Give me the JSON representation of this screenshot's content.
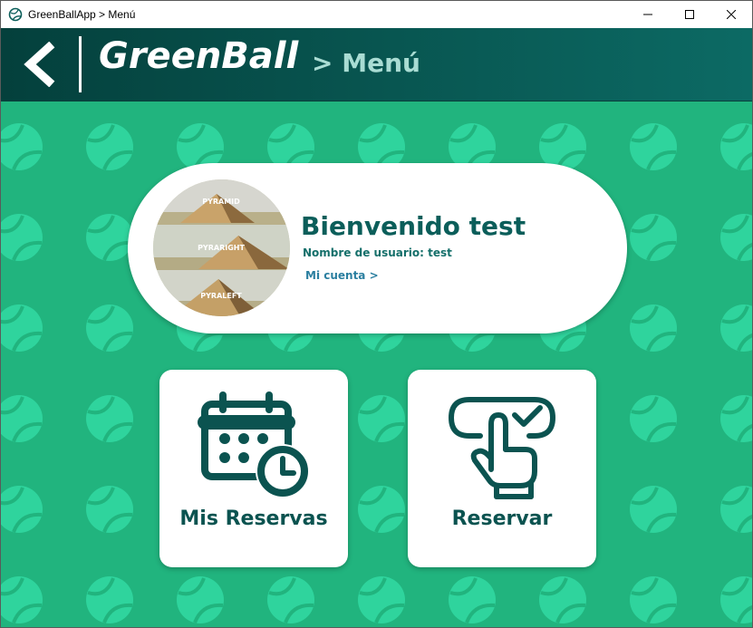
{
  "window": {
    "title": "GreenBallApp > Menú"
  },
  "header": {
    "brand": "GreenBall",
    "crumb": "> Menú"
  },
  "welcome": {
    "title": "Bienvenido test",
    "username_line": "Nombre de usuario: test",
    "account_link": "Mi cuenta >",
    "avatar_labels": [
      "PYRAMID",
      "PYRARIGHT",
      "PYRALEFT"
    ]
  },
  "tiles": {
    "reservas_label": "Mis Reservas",
    "reservar_label": "Reservar"
  },
  "colors": {
    "background": "#21b47e",
    "pattern_ball": "#2fd49d",
    "header_dark": "#04403c",
    "header_light": "#0c6a64",
    "primary_text": "#0b5e5a",
    "icon_color": "#0b5350",
    "link": "#2b7fa0"
  },
  "icons": {
    "back": "chevron-left-icon",
    "reservas": "calendar-clock-icon",
    "reservar": "finger-press-check-icon"
  }
}
